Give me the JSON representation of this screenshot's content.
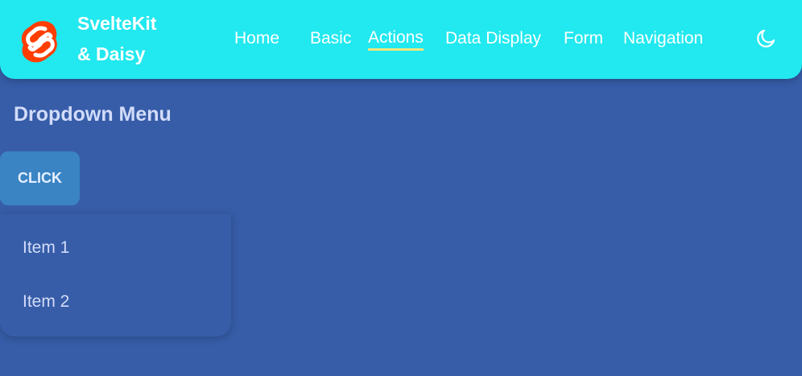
{
  "brand": {
    "line1": "SvelteKit",
    "line2": "& Daisy",
    "logo_icon": "svelte-logo-icon"
  },
  "nav": {
    "items": [
      {
        "label": "Home",
        "active": false
      },
      {
        "label": "Basic",
        "active": false
      },
      {
        "label": "Actions",
        "active": true
      },
      {
        "label": "Data Display",
        "active": false
      },
      {
        "label": "Form",
        "active": false
      },
      {
        "label": "Navigation",
        "active": false
      }
    ],
    "theme_icon": "moon-icon"
  },
  "main": {
    "title": "Dropdown Menu",
    "button_label": "CLICK",
    "menu_items": [
      "Item 1",
      "Item 2"
    ]
  },
  "colors": {
    "navbar_bg": "#22e8ef",
    "page_bg": "#375da8",
    "button_bg": "#3a84c4",
    "logo_red": "#ff3e00",
    "active_underline": "#f2e67a"
  }
}
